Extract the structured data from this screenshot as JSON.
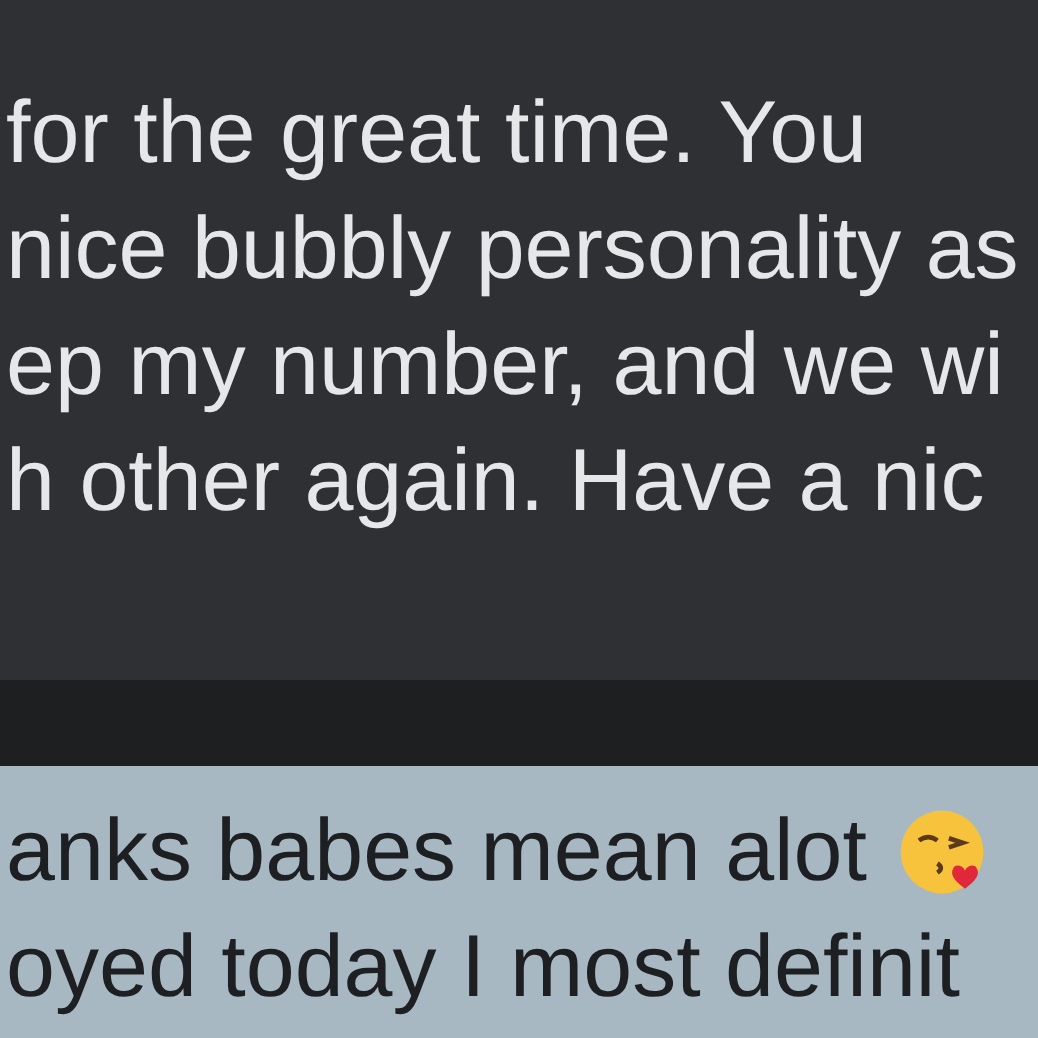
{
  "messages": [
    {
      "kind": "received",
      "lines": [
        "for the great time. You",
        "nice bubbly personality as",
        "ep my number, and we wi",
        "h other again. Have a nic"
      ]
    },
    {
      "kind": "sent",
      "lines": [
        "anks babes mean alot",
        "oyed today I most definit"
      ],
      "emoji": true
    }
  ]
}
